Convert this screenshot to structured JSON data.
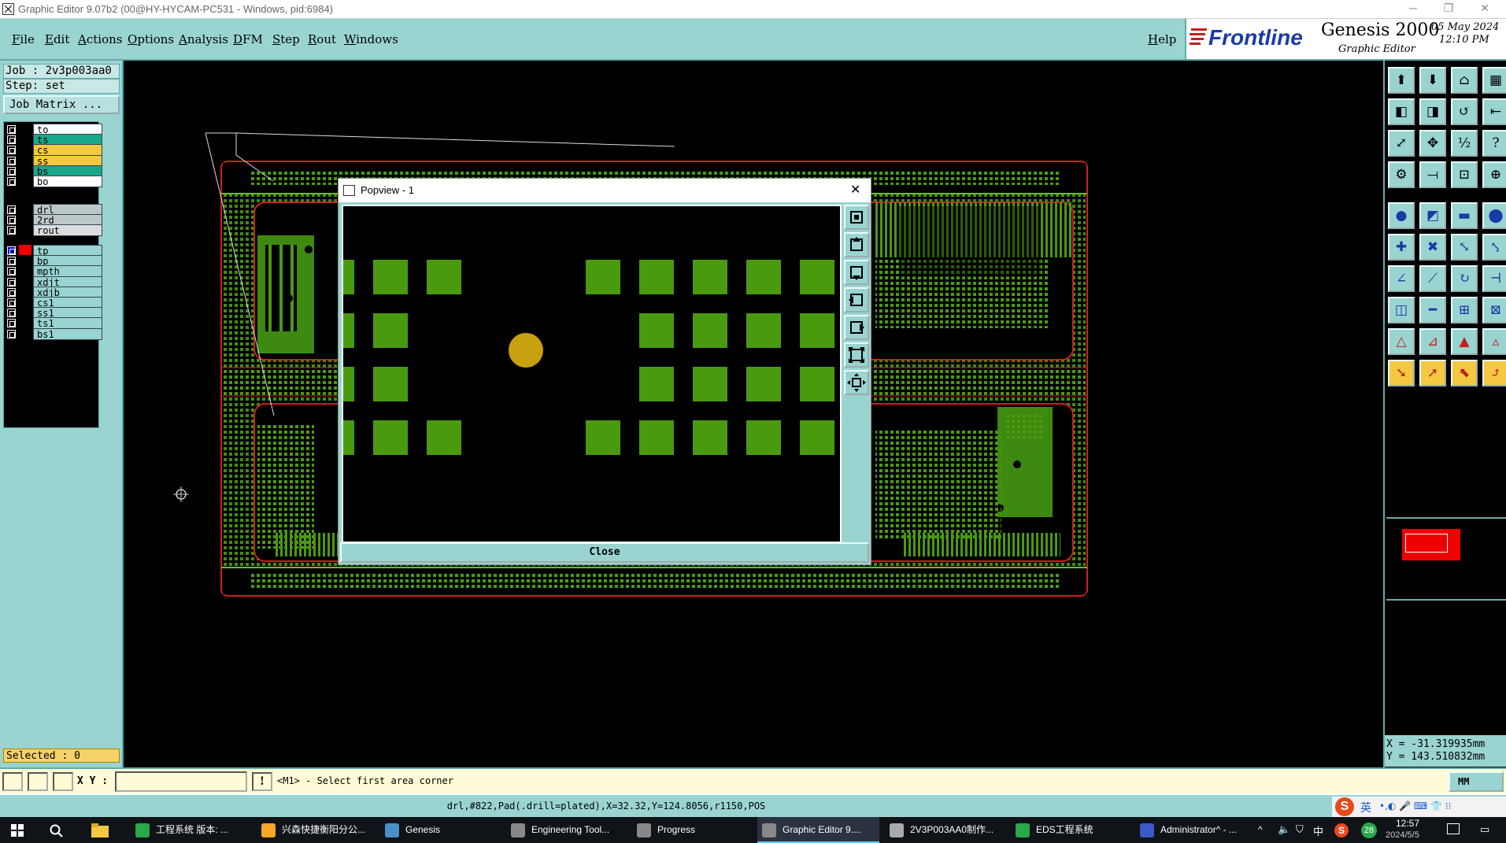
{
  "window": {
    "title": "Graphic Editor 9.07b2 (00@HY-HYCAM-PC531 - Windows, pid:6984)"
  },
  "menu": {
    "items": [
      "File",
      "Edit",
      "Actions",
      "Options",
      "Analysis",
      "DFM",
      "Step",
      "Rout",
      "Windows"
    ],
    "help": "Help"
  },
  "brand": {
    "logo": "Frontline",
    "product": "Genesis 2000",
    "subtitle": "Graphic Editor",
    "date": "05 May 2024",
    "time": "12:10 PM"
  },
  "job": {
    "job_line": "Job : 2v3p003aa0",
    "step_line": "Step: set",
    "matrix_button": "Job Matrix ..."
  },
  "layers": {
    "group1": [
      {
        "name": "to",
        "color": "#ffffff"
      },
      {
        "name": "ts",
        "color": "#1aa88a"
      },
      {
        "name": "cs",
        "color": "#f5c842"
      },
      {
        "name": "ss",
        "color": "#f5c842"
      },
      {
        "name": "bs",
        "color": "#1aa88a"
      },
      {
        "name": "bo",
        "color": "#ffffff"
      }
    ],
    "group2": [
      {
        "name": "drl",
        "color": "#bcc8c8"
      },
      {
        "name": "2rd",
        "color": "#bcc8c8"
      },
      {
        "name": "rout",
        "color": "#dddddd"
      }
    ],
    "group3": [
      {
        "name": "tp",
        "color": "#9ad4d0"
      },
      {
        "name": "bp",
        "color": "#9ad4d0"
      },
      {
        "name": "mpth",
        "color": "#9ad4d0"
      },
      {
        "name": "xdjt",
        "color": "#9ad4d0"
      },
      {
        "name": "xdjb",
        "color": "#9ad4d0"
      },
      {
        "name": "cs1",
        "color": "#9ad4d0"
      },
      {
        "name": "ss1",
        "color": "#9ad4d0"
      },
      {
        "name": "ts1",
        "color": "#9ad4d0"
      },
      {
        "name": "bs1",
        "color": "#9ad4d0"
      }
    ],
    "selected_label": "Selected : 0"
  },
  "popview": {
    "title": "Popview - 1",
    "close_label": "Close"
  },
  "coords": {
    "x_line": "X = -31.319935mm",
    "y_line": "Y =  143.510832mm"
  },
  "cmd": {
    "xy_label": "X Y :",
    "prompt": "<M1> - Select first area corner",
    "mode": "MM"
  },
  "status": {
    "text": "drl,#822,Pad(.drill=plated),X=32.32,Y=124.8056,r1150,POS"
  },
  "taskbar": {
    "items": [
      {
        "label": "工程系统  版本: ...",
        "color": "#2aa84a"
      },
      {
        "label": "兴森快捷衡阳分公...",
        "color": "#f5a623"
      },
      {
        "label": "Genesis",
        "color": "#4a90c8"
      },
      {
        "label": "Engineering Tool...",
        "color": "#888888"
      },
      {
        "label": "Progress",
        "color": "#888888"
      },
      {
        "label": "Graphic Editor 9....",
        "color": "#888888"
      },
      {
        "label": "2V3P003AA0制作...",
        "color": "#aaaaaa"
      },
      {
        "label": "EDS工程系统",
        "color": "#2aa84a"
      },
      {
        "label": "Administrator^ - ...",
        "color": "#3a5ac8"
      }
    ],
    "clock_time": "12:57",
    "clock_date": "2024/5/5",
    "ime": "英",
    "lang": "中",
    "badge": "28"
  },
  "colors": {
    "panel": "#9ad4d0",
    "copper": "#4a9a10",
    "pcb_outline": "#cc2020",
    "drill": "#c9a010"
  }
}
